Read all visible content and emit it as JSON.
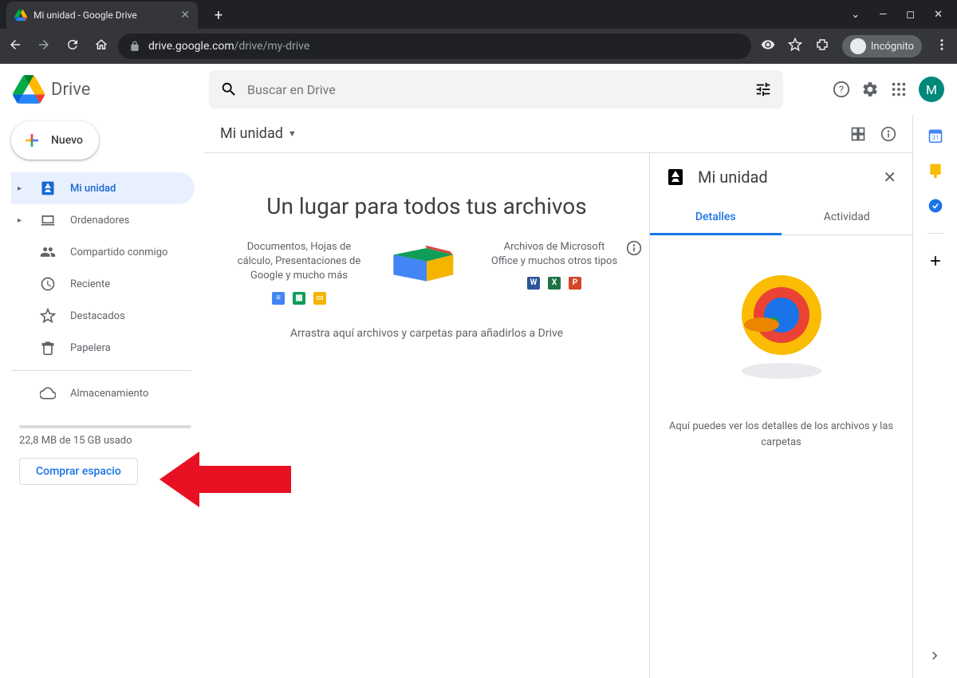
{
  "browser": {
    "tab_title": "Mi unidad - Google Drive",
    "url_domain": "drive.google.com",
    "url_path": "/drive/my-drive",
    "incognito_label": "Incógnito"
  },
  "header": {
    "app_name": "Drive",
    "search_placeholder": "Buscar en Drive",
    "avatar_letter": "M"
  },
  "sidebar": {
    "new_label": "Nuevo",
    "items": {
      "my_drive": "Mi unidad",
      "computers": "Ordenadores",
      "shared": "Compartido conmigo",
      "recent": "Reciente",
      "starred": "Destacados",
      "trash": "Papelera",
      "storage": "Almacenamiento"
    },
    "storage_text": "22,8 MB de 15 GB usado",
    "buy_label": "Comprar espacio"
  },
  "content": {
    "breadcrumb": "Mi unidad",
    "empty_title": "Un lugar para todos tus archivos",
    "left_text": "Documentos, Hojas de cálculo, Presentaciones de Google y mucho más",
    "right_text": "Archivos de Microsoft Office y muchos otros tipos",
    "drag_hint": "Arrastra aquí archivos y carpetas para añadirlos a Drive"
  },
  "details": {
    "title": "Mi unidad",
    "tab_details": "Detalles",
    "tab_activity": "Actividad",
    "empty_text": "Aquí puedes ver los detalles de los archivos y las carpetas"
  }
}
